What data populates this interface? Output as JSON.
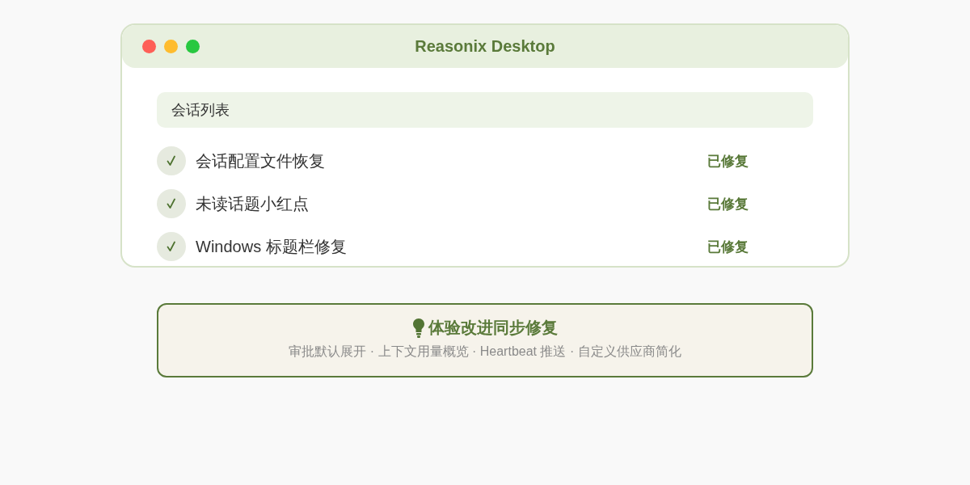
{
  "window": {
    "title": "Reasonix Desktop"
  },
  "list": {
    "header": "会话列表",
    "items": [
      {
        "label": "会话配置文件恢复",
        "status": "已修复"
      },
      {
        "label": "未读话题小红点",
        "status": "已修复"
      },
      {
        "label": "Windows 标题栏修复",
        "status": "已修复"
      }
    ]
  },
  "banner": {
    "title": "体验改进同步修复",
    "subtitle": "审批默认展开 · 上下文用量概览 · Heartbeat 推送 · 自定义供应商简化"
  }
}
